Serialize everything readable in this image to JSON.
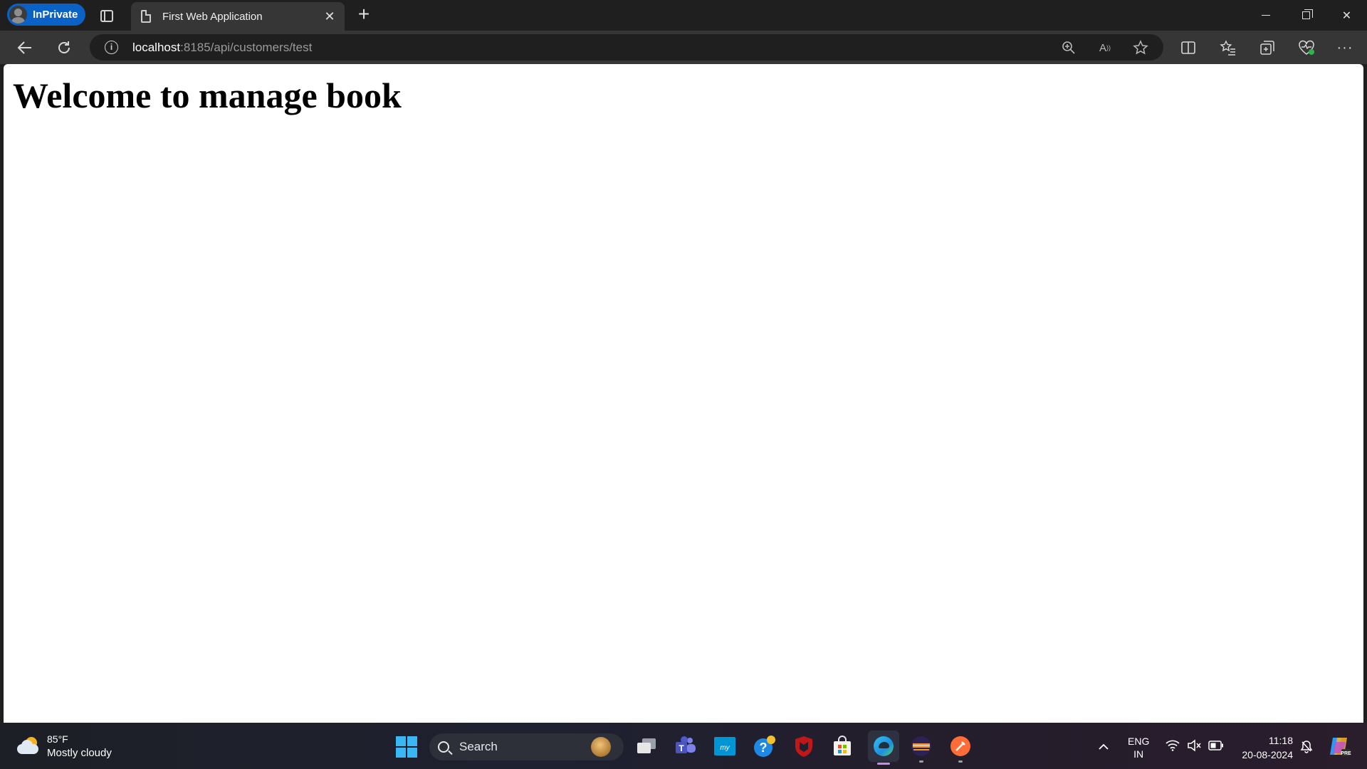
{
  "browser": {
    "profile_label": "InPrivate",
    "tab": {
      "title": "First Web Application"
    },
    "address": {
      "host": "localhost",
      "rest": ":8185/api/customers/test"
    }
  },
  "page": {
    "heading": "Welcome to manage book"
  },
  "taskbar": {
    "weather": {
      "temp": "85°F",
      "desc": "Mostly cloudy"
    },
    "search_label": "Search",
    "language": {
      "line1": "ENG",
      "line2": "IN"
    },
    "clock": {
      "time": "11:18",
      "date": "20-08-2024"
    }
  },
  "colors": {
    "inprivate_blue": "#0a62c7",
    "toolbar": "#363636",
    "titlebar": "#1f1f1f",
    "page_bg": "#ffffff"
  }
}
